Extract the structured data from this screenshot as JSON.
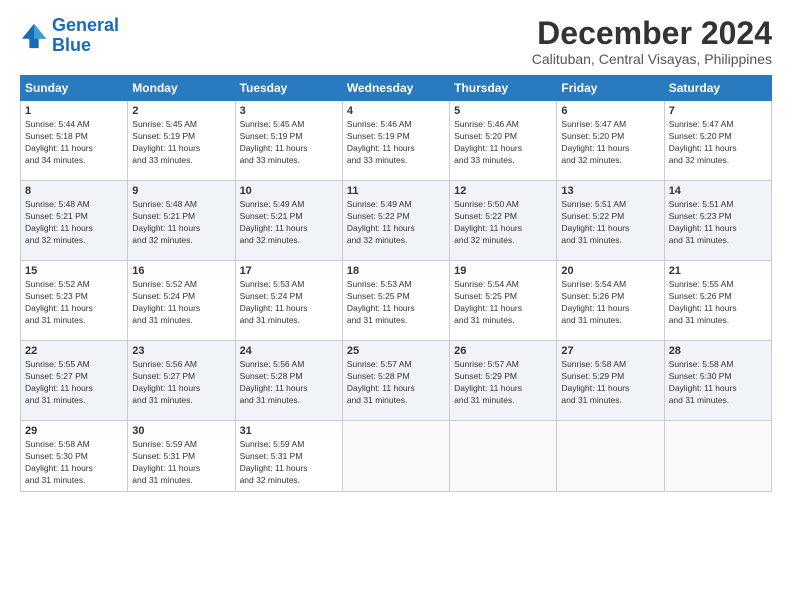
{
  "app": {
    "logo_line1": "General",
    "logo_line2": "Blue"
  },
  "header": {
    "month": "December 2024",
    "location": "Calituban, Central Visayas, Philippines"
  },
  "weekdays": [
    "Sunday",
    "Monday",
    "Tuesday",
    "Wednesday",
    "Thursday",
    "Friday",
    "Saturday"
  ],
  "weeks": [
    [
      {
        "day": "1",
        "info": "Sunrise: 5:44 AM\nSunset: 5:18 PM\nDaylight: 11 hours\nand 34 minutes."
      },
      {
        "day": "2",
        "info": "Sunrise: 5:45 AM\nSunset: 5:19 PM\nDaylight: 11 hours\nand 33 minutes."
      },
      {
        "day": "3",
        "info": "Sunrise: 5:45 AM\nSunset: 5:19 PM\nDaylight: 11 hours\nand 33 minutes."
      },
      {
        "day": "4",
        "info": "Sunrise: 5:46 AM\nSunset: 5:19 PM\nDaylight: 11 hours\nand 33 minutes."
      },
      {
        "day": "5",
        "info": "Sunrise: 5:46 AM\nSunset: 5:20 PM\nDaylight: 11 hours\nand 33 minutes."
      },
      {
        "day": "6",
        "info": "Sunrise: 5:47 AM\nSunset: 5:20 PM\nDaylight: 11 hours\nand 32 minutes."
      },
      {
        "day": "7",
        "info": "Sunrise: 5:47 AM\nSunset: 5:20 PM\nDaylight: 11 hours\nand 32 minutes."
      }
    ],
    [
      {
        "day": "8",
        "info": "Sunrise: 5:48 AM\nSunset: 5:21 PM\nDaylight: 11 hours\nand 32 minutes."
      },
      {
        "day": "9",
        "info": "Sunrise: 5:48 AM\nSunset: 5:21 PM\nDaylight: 11 hours\nand 32 minutes."
      },
      {
        "day": "10",
        "info": "Sunrise: 5:49 AM\nSunset: 5:21 PM\nDaylight: 11 hours\nand 32 minutes."
      },
      {
        "day": "11",
        "info": "Sunrise: 5:49 AM\nSunset: 5:22 PM\nDaylight: 11 hours\nand 32 minutes."
      },
      {
        "day": "12",
        "info": "Sunrise: 5:50 AM\nSunset: 5:22 PM\nDaylight: 11 hours\nand 32 minutes."
      },
      {
        "day": "13",
        "info": "Sunrise: 5:51 AM\nSunset: 5:22 PM\nDaylight: 11 hours\nand 31 minutes."
      },
      {
        "day": "14",
        "info": "Sunrise: 5:51 AM\nSunset: 5:23 PM\nDaylight: 11 hours\nand 31 minutes."
      }
    ],
    [
      {
        "day": "15",
        "info": "Sunrise: 5:52 AM\nSunset: 5:23 PM\nDaylight: 11 hours\nand 31 minutes."
      },
      {
        "day": "16",
        "info": "Sunrise: 5:52 AM\nSunset: 5:24 PM\nDaylight: 11 hours\nand 31 minutes."
      },
      {
        "day": "17",
        "info": "Sunrise: 5:53 AM\nSunset: 5:24 PM\nDaylight: 11 hours\nand 31 minutes."
      },
      {
        "day": "18",
        "info": "Sunrise: 5:53 AM\nSunset: 5:25 PM\nDaylight: 11 hours\nand 31 minutes."
      },
      {
        "day": "19",
        "info": "Sunrise: 5:54 AM\nSunset: 5:25 PM\nDaylight: 11 hours\nand 31 minutes."
      },
      {
        "day": "20",
        "info": "Sunrise: 5:54 AM\nSunset: 5:26 PM\nDaylight: 11 hours\nand 31 minutes."
      },
      {
        "day": "21",
        "info": "Sunrise: 5:55 AM\nSunset: 5:26 PM\nDaylight: 11 hours\nand 31 minutes."
      }
    ],
    [
      {
        "day": "22",
        "info": "Sunrise: 5:55 AM\nSunset: 5:27 PM\nDaylight: 11 hours\nand 31 minutes."
      },
      {
        "day": "23",
        "info": "Sunrise: 5:56 AM\nSunset: 5:27 PM\nDaylight: 11 hours\nand 31 minutes."
      },
      {
        "day": "24",
        "info": "Sunrise: 5:56 AM\nSunset: 5:28 PM\nDaylight: 11 hours\nand 31 minutes."
      },
      {
        "day": "25",
        "info": "Sunrise: 5:57 AM\nSunset: 5:28 PM\nDaylight: 11 hours\nand 31 minutes."
      },
      {
        "day": "26",
        "info": "Sunrise: 5:57 AM\nSunset: 5:29 PM\nDaylight: 11 hours\nand 31 minutes."
      },
      {
        "day": "27",
        "info": "Sunrise: 5:58 AM\nSunset: 5:29 PM\nDaylight: 11 hours\nand 31 minutes."
      },
      {
        "day": "28",
        "info": "Sunrise: 5:58 AM\nSunset: 5:30 PM\nDaylight: 11 hours\nand 31 minutes."
      }
    ],
    [
      {
        "day": "29",
        "info": "Sunrise: 5:58 AM\nSunset: 5:30 PM\nDaylight: 11 hours\nand 31 minutes."
      },
      {
        "day": "30",
        "info": "Sunrise: 5:59 AM\nSunset: 5:31 PM\nDaylight: 11 hours\nand 31 minutes."
      },
      {
        "day": "31",
        "info": "Sunrise: 5:59 AM\nSunset: 5:31 PM\nDaylight: 11 hours\nand 32 minutes."
      },
      {
        "day": "",
        "info": ""
      },
      {
        "day": "",
        "info": ""
      },
      {
        "day": "",
        "info": ""
      },
      {
        "day": "",
        "info": ""
      }
    ]
  ]
}
